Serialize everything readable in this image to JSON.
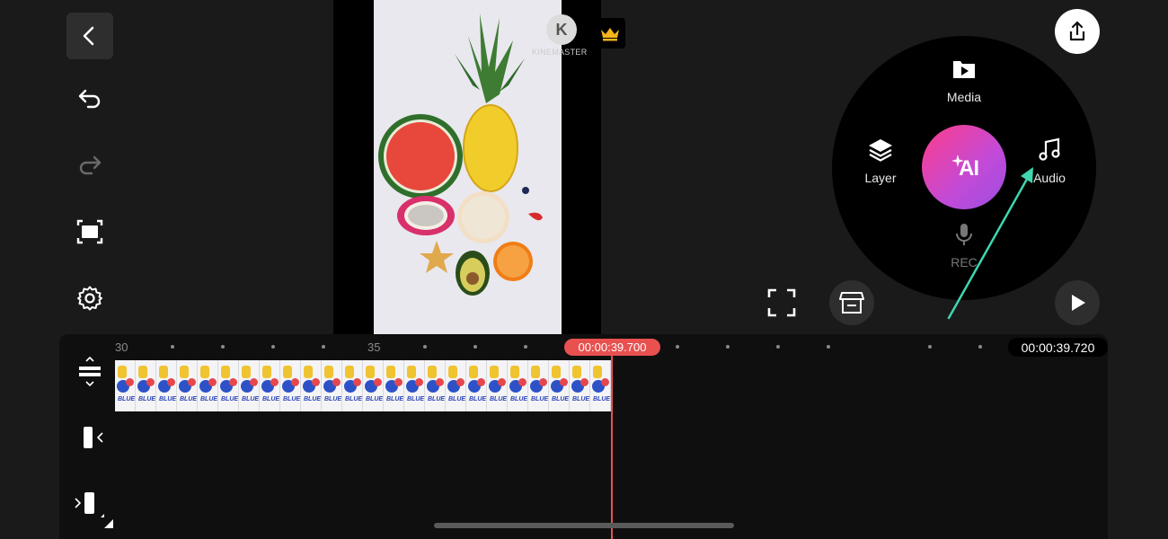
{
  "toolbar_left": {
    "icons": [
      "back-icon",
      "undo-icon",
      "redo-icon",
      "capture-icon",
      "settings-icon"
    ]
  },
  "preview": {
    "watermark_label": "KINEMASTER",
    "premium_icon": "crown-icon"
  },
  "radial_menu": {
    "media_label": "Media",
    "layer_label": "Layer",
    "audio_label": "Audio",
    "rec_label": "REC",
    "ai_label": "AI"
  },
  "timeline": {
    "ruler_labels": [
      "30",
      "35"
    ],
    "playhead_time": "00:00:39.700",
    "end_time": "00:00:39.720",
    "clip_thumb_text": "BLUE"
  },
  "colors": {
    "accent_red": "#e8514f",
    "annotation_arrow": "#3fd6b0",
    "ai_gradient_start": "#ff3c8a",
    "ai_gradient_end": "#9b4ce2"
  }
}
